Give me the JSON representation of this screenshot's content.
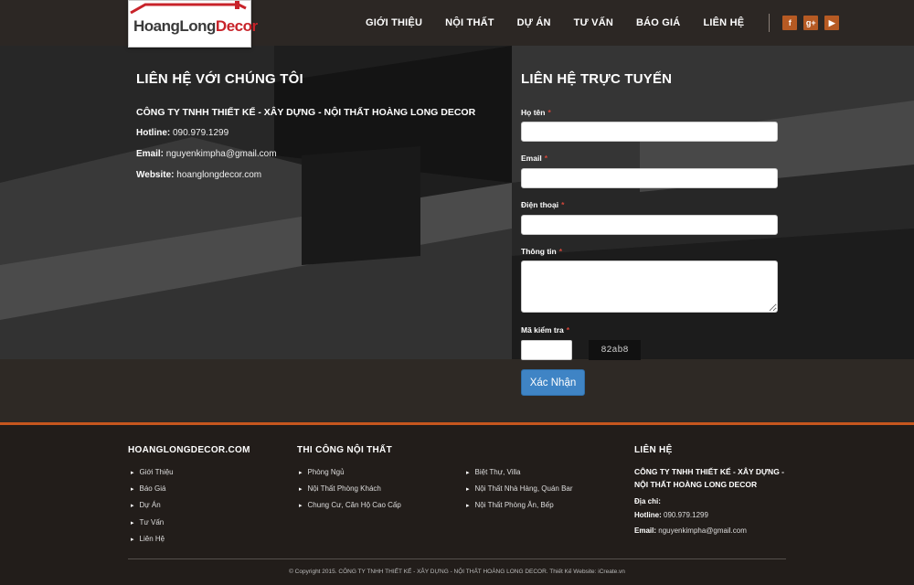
{
  "header": {
    "logo_text_1": "HoangLong",
    "logo_text_2": "Decor",
    "nav": [
      "GIỚI THIỆU",
      "NỘI THẤT",
      "DỰ ÁN",
      "TƯ VẤN",
      "BÁO GIÁ",
      "LIÊN HỆ"
    ],
    "social": [
      {
        "icon": "facebook-icon",
        "glyph": "f"
      },
      {
        "icon": "google-plus-icon",
        "glyph": "g+"
      },
      {
        "icon": "youtube-icon",
        "glyph": "▶"
      }
    ],
    "accent_color": "#b65a23"
  },
  "contact": {
    "title": "LIÊN HỆ VỚI CHÚNG TÔI",
    "company": "CÔNG TY TNHH THIẾT KẾ - XÂY DỰNG - NỘI THẤT HOÀNG LONG DECOR",
    "hotline_label": "Hotline:",
    "hotline": "090.979.1299",
    "email_label": "Email:",
    "email": "nguyenkimpha@gmail.com",
    "website_label": "Website:",
    "website": "hoanglongdecor.com"
  },
  "form": {
    "title": "LIÊN HỆ TRỰC TUYẾN",
    "name_label": "Họ tên",
    "email_label": "Email",
    "phone_label": "Điện thoại",
    "message_label": "Thông tin",
    "captcha_label": "Mã kiểm tra",
    "required_mark": "*",
    "captcha_code": "82ab8",
    "submit_label": "Xác Nhận",
    "button_color": "#3f84c5"
  },
  "footer": {
    "col1_title": "HOANGLONGDECOR.COM",
    "col1_links": [
      "Giới Thiệu",
      "Báo Giá",
      "Dự Án",
      "Tư Vấn",
      "Liên Hệ"
    ],
    "col2_title": "THI CÔNG NỘI THẤT",
    "col2_links": [
      "Phòng Ngủ",
      "Nội Thất Phòng Khách",
      "Chung Cư, Căn Hộ Cao Cấp"
    ],
    "col3_links": [
      "Biệt Thự, Villa",
      "Nội Thất Nhà Hàng, Quán Bar",
      "Nội Thất Phòng Ăn, Bếp"
    ],
    "col4_title": "LIÊN HỆ",
    "col4_company": "CÔNG TY TNHH THIẾT KẾ - XÂY DỰNG - NỘI THẤT HOÀNG LONG DECOR",
    "address_label": "Địa chỉ:",
    "hotline_label": "Hotline:",
    "hotline": "090.979.1299",
    "email_label": "Email:",
    "email": "nguyenkimpha@gmail.com",
    "copyright": "© Copyright 2015. CÔNG TY TNHH THIẾT KẾ - XÂY DỰNG - NỘI THẤT HOÀNG LONG DECOR. Thiết Kế Website: iCreate.vn",
    "divider_color": "#c6561e"
  }
}
